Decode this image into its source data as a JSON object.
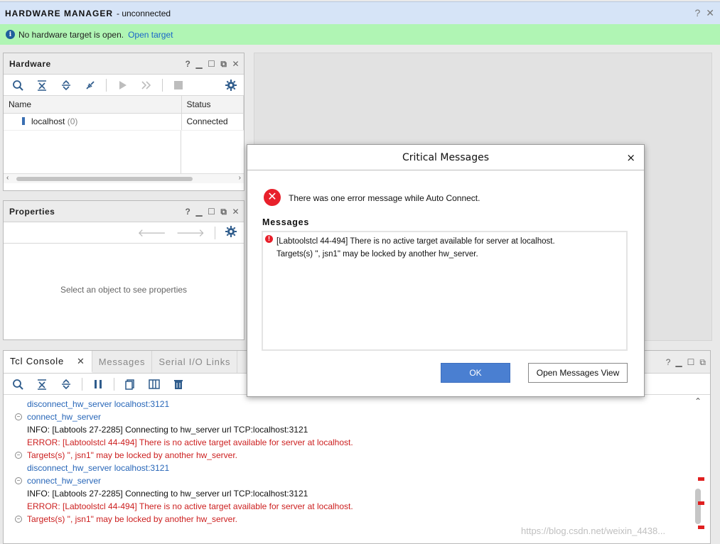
{
  "header": {
    "title": "HARDWARE MANAGER",
    "subtitle": "- unconnected",
    "help_icon": "?",
    "close_icon": "✕"
  },
  "info_bar": {
    "message": "No hardware target is open.",
    "link": "Open target",
    "icon": "info-icon"
  },
  "hardware_panel": {
    "title": "Hardware",
    "columns": [
      "Name",
      "Status"
    ],
    "rows": [
      {
        "name": "localhost",
        "count": "(0)",
        "status": "Connected"
      }
    ]
  },
  "properties_panel": {
    "title": "Properties",
    "empty_text": "Select an object to see properties"
  },
  "console": {
    "tabs": [
      "Tcl Console",
      "Messages",
      "Serial I/O Links"
    ],
    "lines": [
      {
        "text": "disconnect_hw_server localhost:3121",
        "style": "blue",
        "fold": false
      },
      {
        "text": "connect_hw_server",
        "style": "blue",
        "fold": true
      },
      {
        "text": "INFO: [Labtools 27-2285] Connecting to hw_server url TCP:localhost:3121",
        "style": "black",
        "fold": false
      },
      {
        "text": "ERROR: [Labtoolstcl 44-494] There is no active target available for server at localhost.",
        "style": "red",
        "fold": false
      },
      {
        "text": " Targets(s) \", jsn1\" may be locked by another hw_server.",
        "style": "red",
        "fold": true
      },
      {
        "text": "disconnect_hw_server localhost:3121",
        "style": "blue",
        "fold": false
      },
      {
        "text": "connect_hw_server",
        "style": "blue",
        "fold": true
      },
      {
        "text": "INFO: [Labtools 27-2285] Connecting to hw_server url TCP:localhost:3121",
        "style": "black",
        "fold": false
      },
      {
        "text": "ERROR: [Labtoolstcl 44-494] There is no active target available for server at localhost.",
        "style": "red",
        "fold": false
      },
      {
        "text": " Targets(s) \", jsn1\" may be locked by another hw_server.",
        "style": "red",
        "fold": true
      }
    ]
  },
  "dialog": {
    "title": "Critical Messages",
    "close": "×",
    "summary": "There was one error message while Auto Connect.",
    "messages_label": "Messages",
    "message_line1": "[Labtoolstcl 44-494] There is no active target available for server at localhost.",
    "message_line2": "Targets(s) \", jsn1\" may be locked by another hw_server.",
    "ok_label": "OK",
    "open_view_label": "Open Messages View"
  },
  "watermark": "https://blog.csdn.net/weixin_4438...",
  "colors": {
    "header_bg": "#d6e4f7",
    "info_bg": "#b0f5b4",
    "error_red": "#e8202b",
    "ok_blue": "#4a7fd1",
    "link_blue": "#1a66c9"
  }
}
